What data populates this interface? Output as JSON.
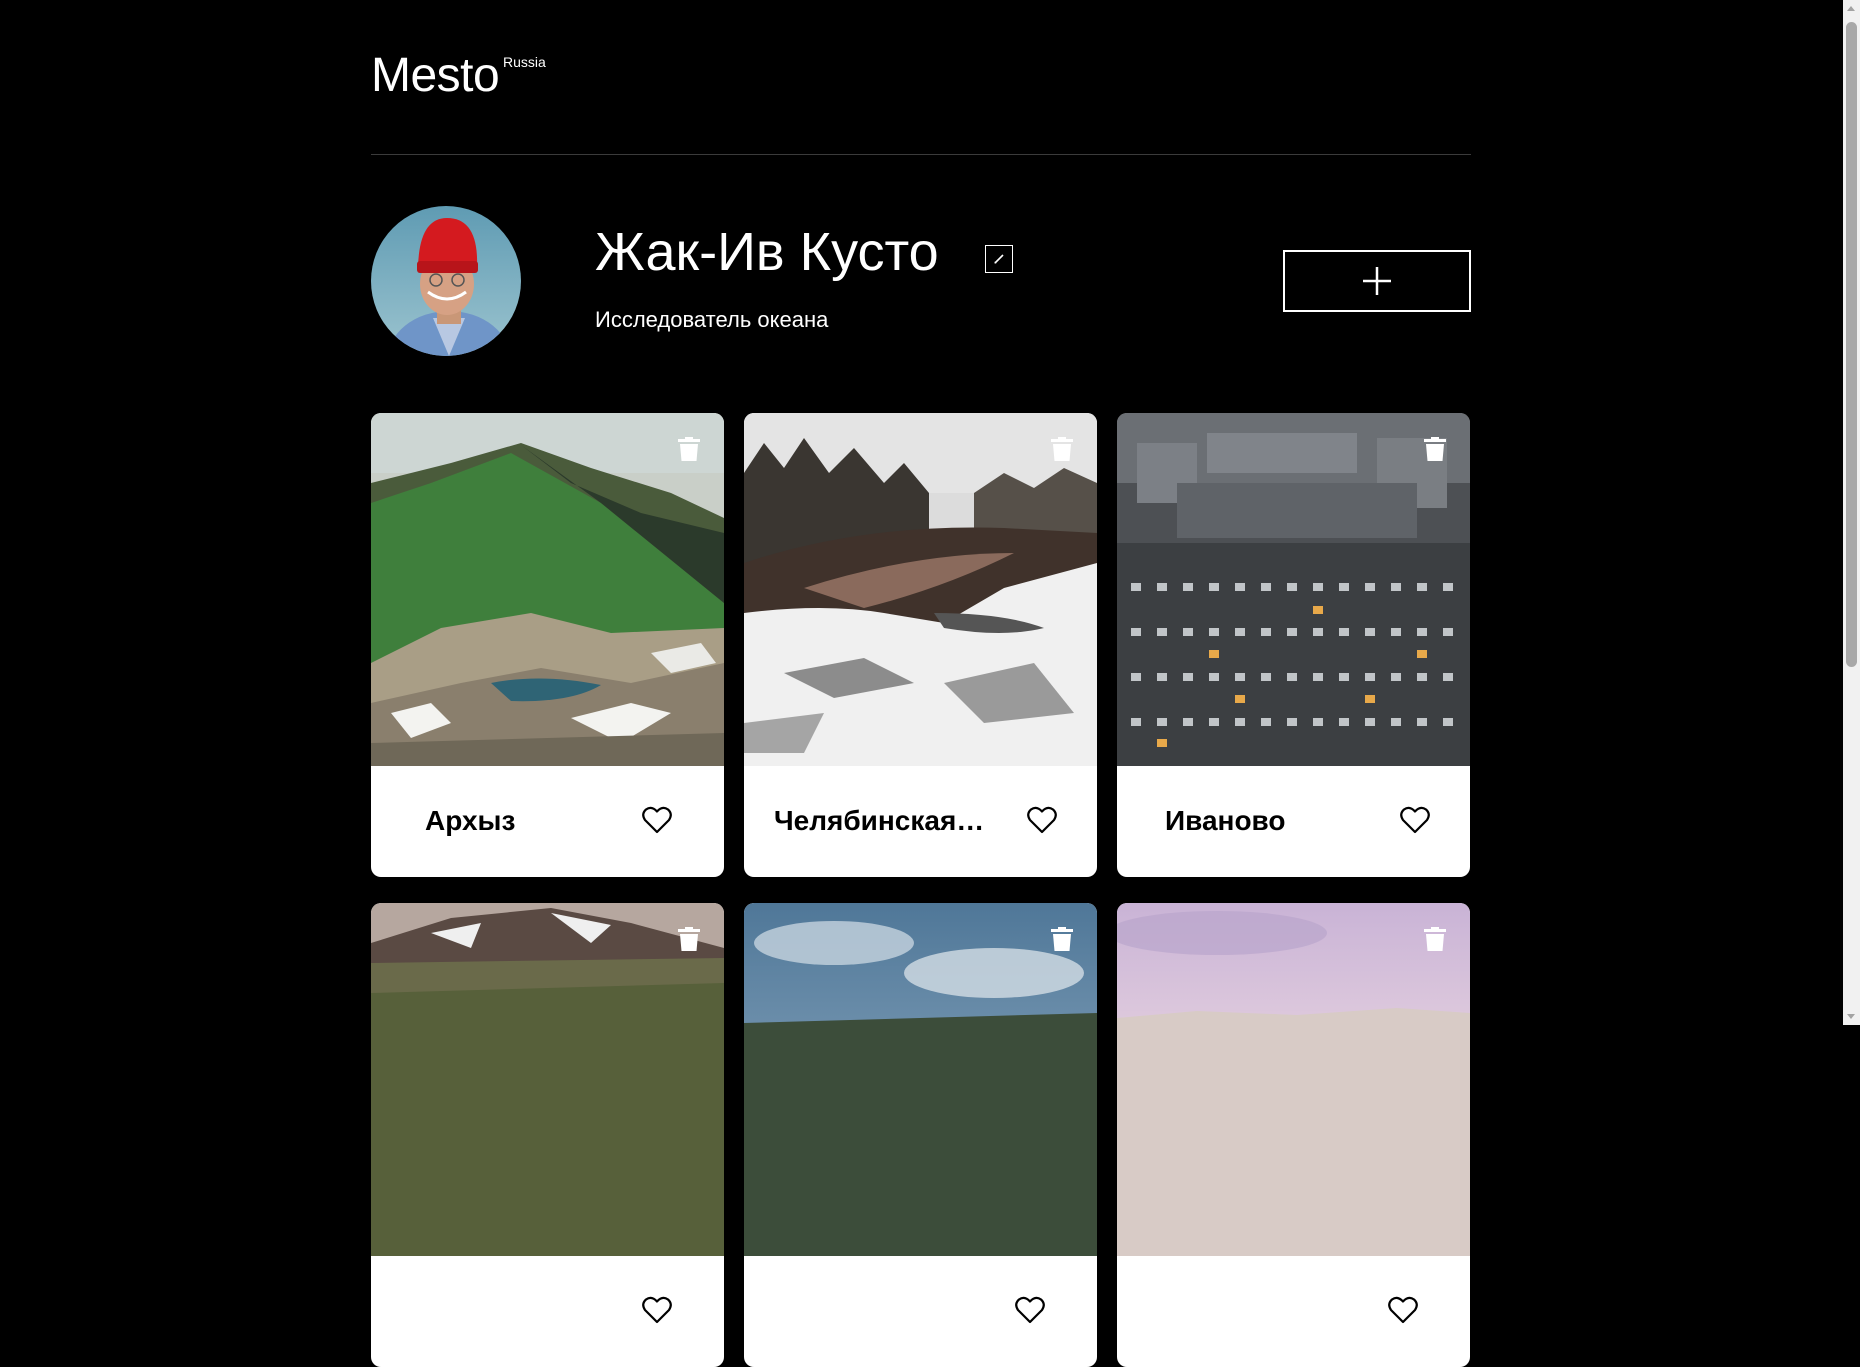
{
  "header": {
    "logo": "Mesto",
    "logo_sub": "Russia"
  },
  "profile": {
    "name": "Жак-Ив Кусто",
    "about": "Исследователь океана",
    "edit_icon": "pencil-icon",
    "add_icon": "plus-icon"
  },
  "cards": [
    {
      "title": "Архыз",
      "liked": false
    },
    {
      "title": "Челябинская область",
      "liked": false
    },
    {
      "title": "Иваново",
      "liked": false
    },
    {
      "title": "",
      "liked": false
    },
    {
      "title": "",
      "liked": false
    },
    {
      "title": "",
      "liked": false
    }
  ],
  "colors": {
    "background": "#000000",
    "card": "#ffffff",
    "divider": "#545454"
  }
}
